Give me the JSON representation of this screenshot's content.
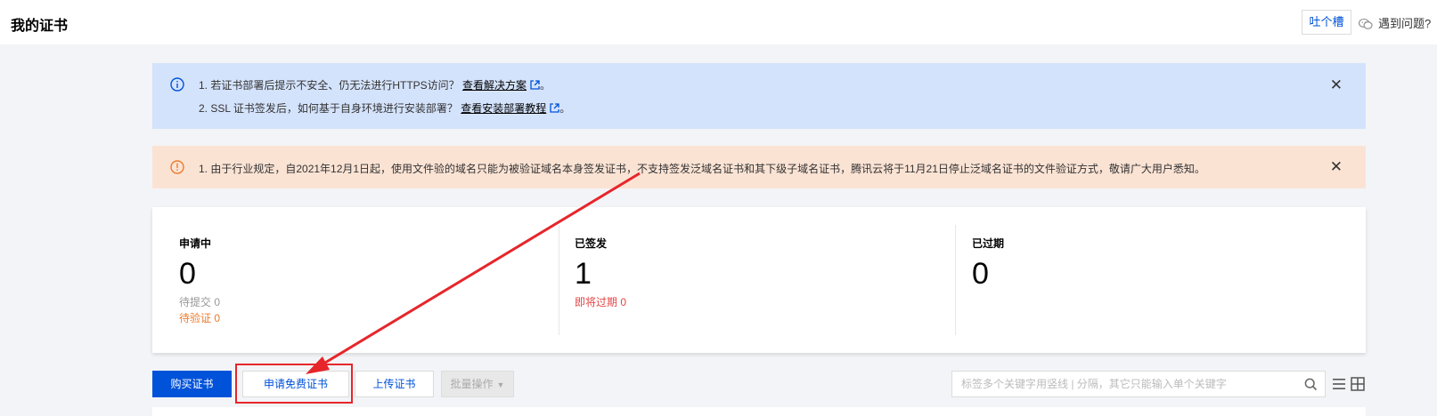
{
  "header": {
    "title": "我的证书",
    "tucao_label": "吐个槽",
    "help_label": "遇到问题?"
  },
  "banners": {
    "info": {
      "line1_prefix": "1. 若证书部署后提示不安全、仍无法进行HTTPS访问？",
      "line1_link": "查看解决方案",
      "line1_suffix": "。",
      "line2_prefix": "2. SSL 证书签发后，如何基于自身环境进行安装部署？",
      "line2_link": "查看安装部署教程",
      "line2_suffix": "。"
    },
    "warning": {
      "text": "1. 由于行业规定，自2021年12月1日起，使用文件验的域名只能为被验证域名本身签发证书，不支持签发泛域名证书和其下级子域名证书，腾讯云将于11月21日停止泛域名证书的文件验证方式，敬请广大用户悉知。"
    }
  },
  "stats": {
    "applying": {
      "label": "申请中",
      "count": "0",
      "pending_submit": "待提交 0",
      "pending_verify": "待验证 0"
    },
    "issued": {
      "label": "已签发",
      "count": "1",
      "expiring": "即将过期 0"
    },
    "expired": {
      "label": "已过期",
      "count": "0"
    }
  },
  "toolbar": {
    "buy_label": "购买证书",
    "free_label": "申请免费证书",
    "upload_label": "上传证书",
    "batch_label": "批量操作",
    "search_placeholder": "标签多个关键字用竖线 | 分隔，其它只能输入单个关键字"
  },
  "colors": {
    "primary": "#0052d9",
    "info_bg": "#d4e3fc",
    "warn_bg": "#fbe3d4",
    "warn_icon": "#ed7b2f",
    "danger": "#e54545",
    "annotation": "#e6262b"
  },
  "icons": {
    "info": "info-circle-icon",
    "warning": "warning-circle-icon",
    "close": "close-icon",
    "external": "external-link-icon",
    "chat": "wechat-chat-icon",
    "search": "search-icon",
    "list_view": "list-view-icon",
    "grid_view": "grid-view-icon"
  }
}
